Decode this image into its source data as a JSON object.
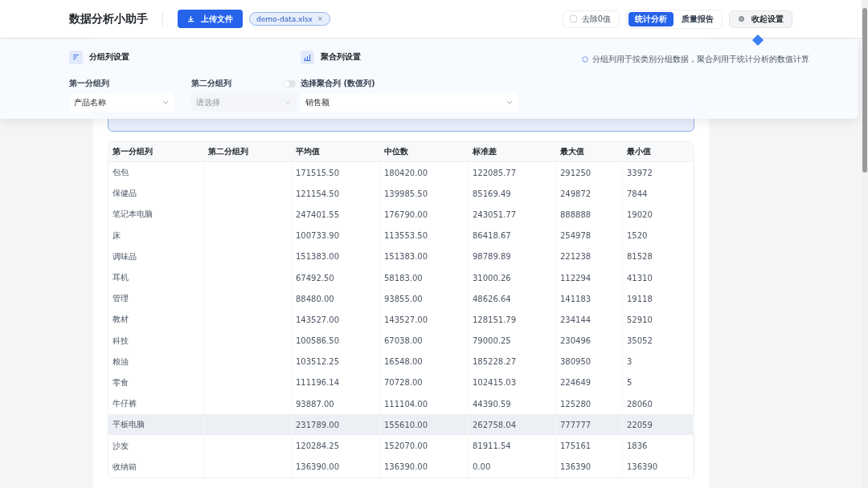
{
  "header": {
    "title": "数据分析小助手",
    "upload_button": "上传文件",
    "file_chip": {
      "name": "demo-data.xlsx",
      "close": "×"
    },
    "remove_zero": {
      "label": "去除0值",
      "checked": false
    },
    "tabs": [
      {
        "label": "统计分析",
        "selected": true
      },
      {
        "label": "质量报告",
        "selected": false
      }
    ],
    "collapse_button": "收起设置"
  },
  "settings": {
    "group_section": {
      "title": "分组列设置",
      "first": {
        "label": "第一分组列",
        "value": "产品名称"
      },
      "second": {
        "label": "第二分组列",
        "enabled": false,
        "placeholder": "请选择"
      }
    },
    "agg_section": {
      "title": "聚合列设置",
      "field": {
        "label": "选择聚合列 (数值列)",
        "value": "销售额"
      }
    },
    "hint": "分组列用于按类别分组数据，聚合列用于统计分析的数值计算"
  },
  "table": {
    "columns": [
      "第一分组列",
      "第二分组列",
      "平均值",
      "中位数",
      "标准差",
      "最大值",
      "最小值"
    ],
    "rows": [
      {
        "cells": [
          "包包",
          "",
          "171515.50",
          "180420.00",
          "122085.77",
          "291250",
          "33972"
        ],
        "hovered": false
      },
      {
        "cells": [
          "保健品",
          "",
          "121154.50",
          "139985.50",
          "85169.49",
          "249872",
          "7844"
        ],
        "hovered": false
      },
      {
        "cells": [
          "笔记本电脑",
          "",
          "247401.55",
          "176790.00",
          "243051.77",
          "888888",
          "19020"
        ],
        "hovered": false
      },
      {
        "cells": [
          "床",
          "",
          "100733.90",
          "113553.50",
          "86418.67",
          "254978",
          "1520"
        ],
        "hovered": false
      },
      {
        "cells": [
          "调味品",
          "",
          "151383.00",
          "151383.00",
          "98789.89",
          "221238",
          "81528"
        ],
        "hovered": false
      },
      {
        "cells": [
          "耳机",
          "",
          "67492.50",
          "58183.00",
          "31000.26",
          "112294",
          "41310"
        ],
        "hovered": false
      },
      {
        "cells": [
          "管理",
          "",
          "88480.00",
          "93855.00",
          "48626.64",
          "141183",
          "19118"
        ],
        "hovered": false
      },
      {
        "cells": [
          "教材",
          "",
          "143527.00",
          "143527.00",
          "128151.79",
          "234144",
          "52910"
        ],
        "hovered": false
      },
      {
        "cells": [
          "科技",
          "",
          "100586.50",
          "67038.00",
          "79000.25",
          "230496",
          "35052"
        ],
        "hovered": false
      },
      {
        "cells": [
          "粮油",
          "",
          "103512.25",
          "16548.00",
          "185228.27",
          "380950",
          "3"
        ],
        "hovered": false
      },
      {
        "cells": [
          "零食",
          "",
          "111196.14",
          "70728.00",
          "102415.03",
          "224649",
          "5"
        ],
        "hovered": false
      },
      {
        "cells": [
          "牛仔裤",
          "",
          "93887.00",
          "111104.00",
          "44390.59",
          "125280",
          "28060"
        ],
        "hovered": false
      },
      {
        "cells": [
          "平板电脑",
          "",
          "231789.00",
          "155610.00",
          "262758.04",
          "777777",
          "22059"
        ],
        "hovered": true
      },
      {
        "cells": [
          "沙发",
          "",
          "120284.25",
          "152070.00",
          "81911.54",
          "175161",
          "1836"
        ],
        "hovered": false
      },
      {
        "cells": [
          "收纳箱",
          "",
          "136390.00",
          "136390.00",
          "0.00",
          "136390",
          "136390"
        ],
        "hovered": false
      }
    ]
  }
}
